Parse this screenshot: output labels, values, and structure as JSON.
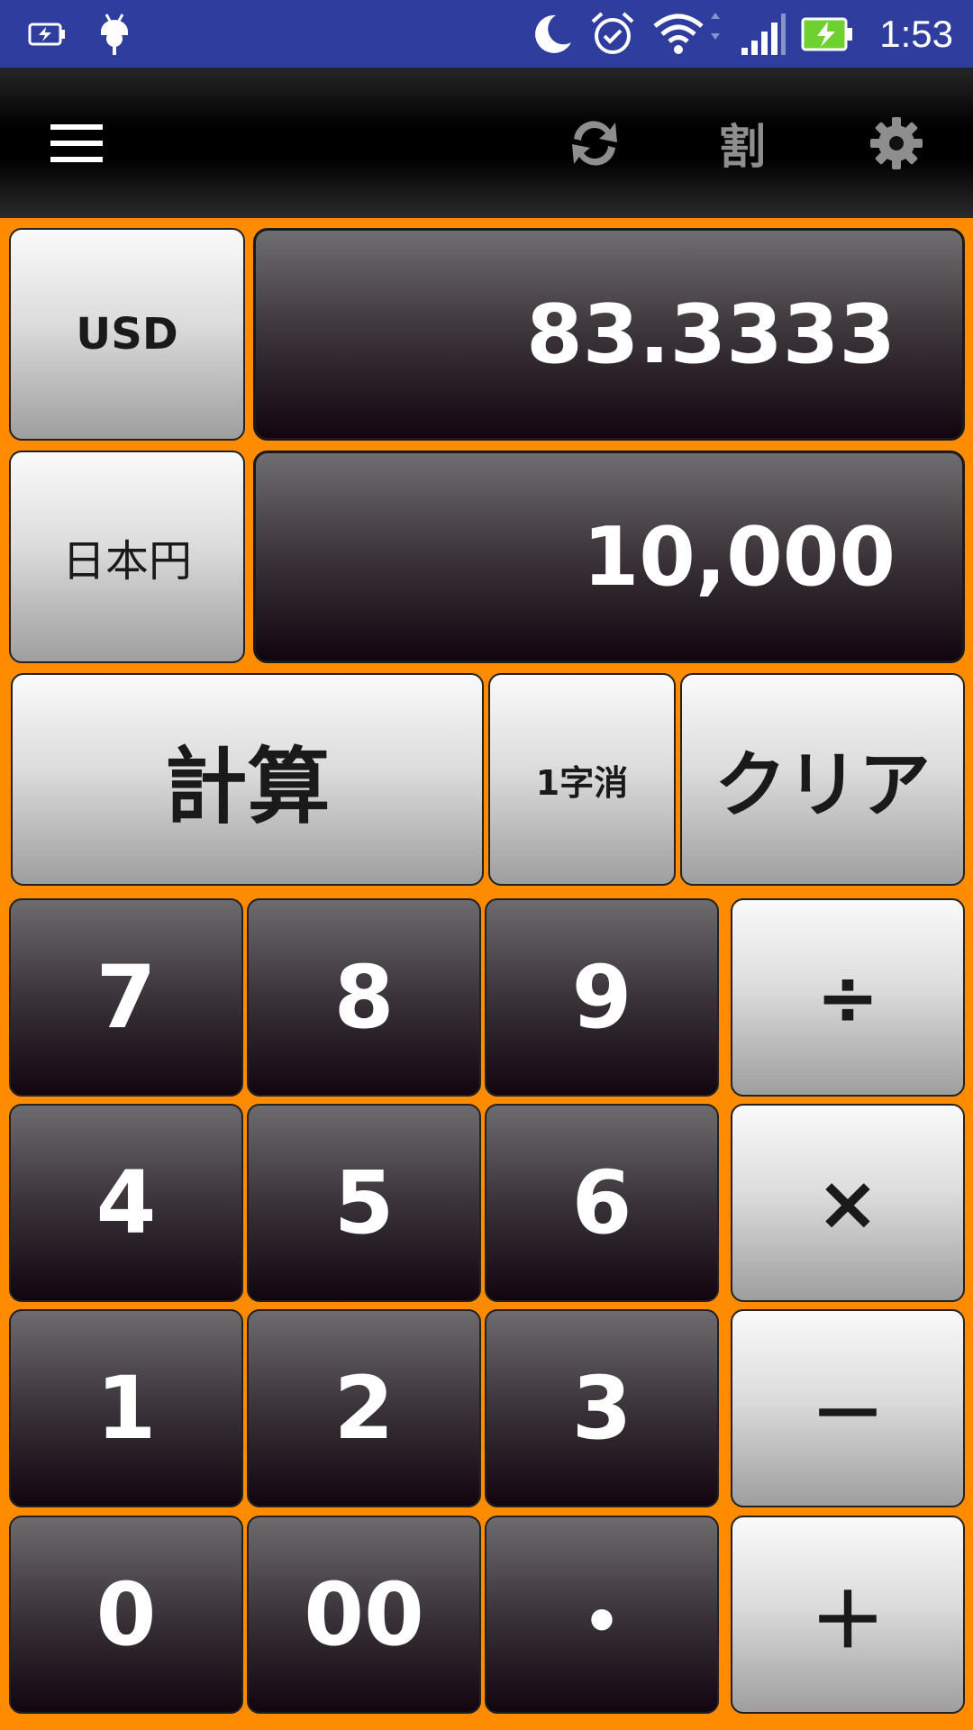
{
  "status_bar": {
    "time": "1:53",
    "icons": [
      "battery-saver-icon",
      "android-debug-icon",
      "moon-icon",
      "alarm-icon",
      "wifi-icon",
      "signal-icon",
      "battery-charging-icon"
    ]
  },
  "toolbar": {
    "menu_icon": "menu-icon",
    "swap_icon": "swap-icon",
    "discount_label": "割",
    "settings_icon": "gear-icon"
  },
  "currency": {
    "from_code": "USD",
    "from_value": "83.3333",
    "to_code": "日本円",
    "to_value": "10,000"
  },
  "actions": {
    "calculate": "計算",
    "backspace": "1字消",
    "clear": "クリア"
  },
  "keypad": {
    "k7": "7",
    "k8": "8",
    "k9": "9",
    "k4": "4",
    "k5": "5",
    "k6": "6",
    "k1": "1",
    "k2": "2",
    "k3": "3",
    "k0": "0",
    "k00": "00",
    "dot": "・",
    "divide": "÷",
    "multiply": "×",
    "minus": "－",
    "plus": "＋"
  },
  "colors": {
    "status_bar": "#2f3e9e",
    "background": "#ff8c00",
    "battery_fill": "#6fd12f"
  }
}
